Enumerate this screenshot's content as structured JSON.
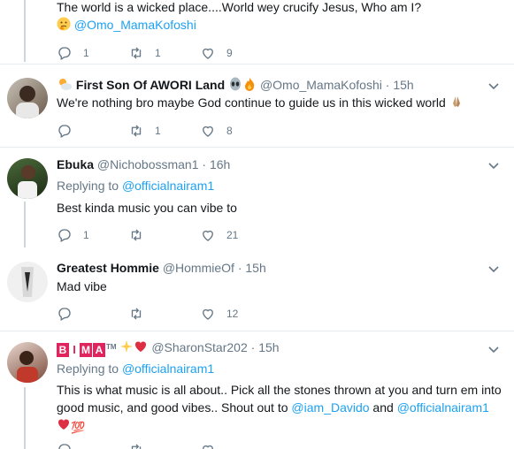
{
  "tweets": [
    {
      "text_line1": "The world is a wicked place....World wey crucify Jesus, Who am I?",
      "mention": "@Omo_MamaKofoshi",
      "replies": "1",
      "retweets": "1",
      "likes": "9"
    },
    {
      "name": "First Son Of AWORI Land",
      "handle": "@Omo_MamaKofoshi",
      "time": "15h",
      "text": "We're nothing bro maybe God continue to guide us in this wicked world",
      "replies": "",
      "retweets": "1",
      "likes": "8"
    },
    {
      "name": "Ebuka",
      "handle": "@Nichobossman1",
      "time": "16h",
      "replying_label": "Replying to",
      "replying_to": "@officialnairam1",
      "text": "Best kinda music you can vibe to",
      "replies": "1",
      "retweets": "",
      "likes": "21"
    },
    {
      "name": "Greatest Hommie",
      "handle": "@HommieOf",
      "time": "15h",
      "text": "Mad vibe",
      "replies": "",
      "retweets": "",
      "likes": "12"
    },
    {
      "name": "BIMA",
      "name_suffix": "TM",
      "handle": "@SharonStar202",
      "time": "15h",
      "replying_label": "Replying to",
      "replying_to": "@officialnairam1",
      "text_a": "This is what music is all about.. Pick all the stones thrown at you and turn em into good music, and  good vibes.. Shout out to ",
      "mention1": "@iam_Davido",
      "text_b": " and ",
      "mention2": "@officialnairam1",
      "emoji_100": "💯"
    }
  ],
  "dot": "·",
  "colors": {
    "link": "#1da1f2",
    "muted": "#657786",
    "divider": "#e6ecf0",
    "thread": "#ccd6dd"
  }
}
